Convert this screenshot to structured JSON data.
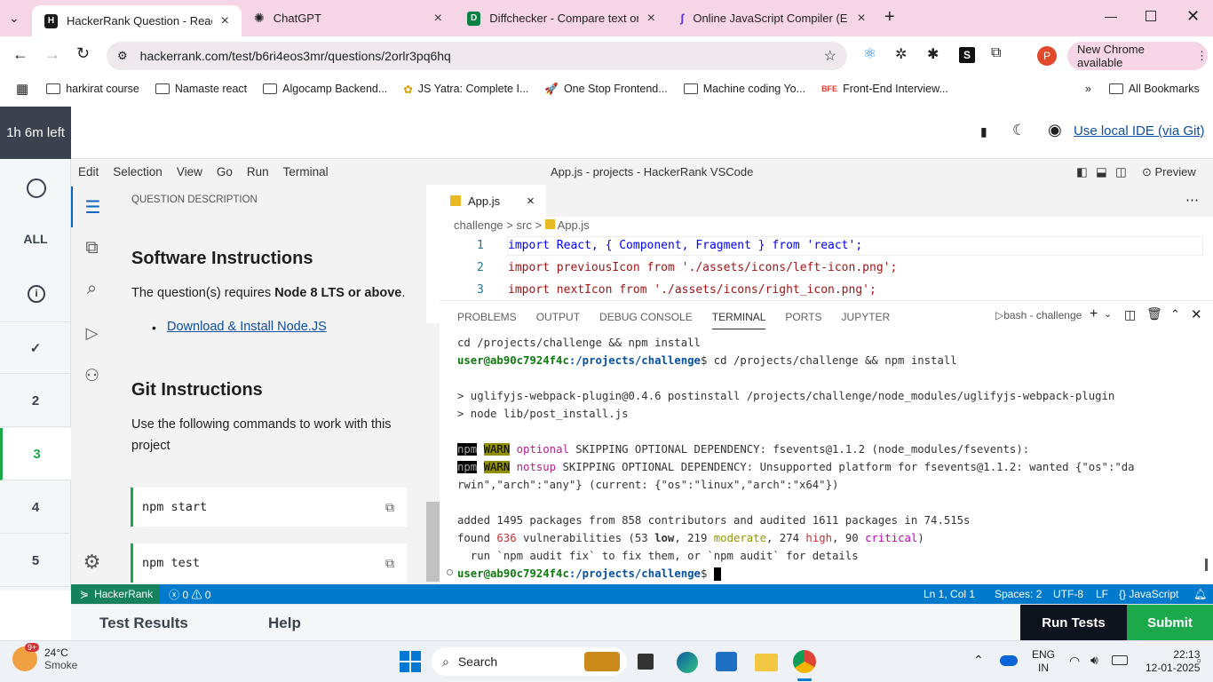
{
  "browser": {
    "tabs": [
      {
        "title": "HackerRank Question - React: C",
        "favicon": "H",
        "color": "#1a1a1a"
      },
      {
        "title": "ChatGPT",
        "favicon": "openai-icon"
      },
      {
        "title": "Diffchecker - Compare text onli",
        "favicon": "D",
        "color": "#0b8043"
      },
      {
        "title": "Online JavaScript Compiler (Edi",
        "favicon": "programiz-icon"
      }
    ],
    "url": "hackerrank.com/test/b6ri4eos3mr/questions/2orlr3pq6hq",
    "profile_letter": "P",
    "update_label": "New Chrome available",
    "bookmarks": [
      "harkirat course",
      "Namaste react",
      "Algocamp Backend...",
      "JS Yatra: Complete I...",
      "One Stop Frontend...",
      "Machine coding Yo...",
      "Front-End Interview..."
    ],
    "all_bookmarks": "All Bookmarks"
  },
  "hr": {
    "timer": "1h 6m left",
    "ide_link": "Use local IDE (via Git)",
    "nav_all": "ALL",
    "questions": [
      "2",
      "3",
      "4",
      "5"
    ],
    "active_question": "3",
    "bottom_tabs": [
      "Test Results",
      "Help"
    ],
    "run_tests": "Run Tests",
    "submit": "Submit"
  },
  "vscode": {
    "menu": [
      "Edit",
      "Selection",
      "View",
      "Go",
      "Run",
      "Terminal"
    ],
    "window_title": "App.js - projects - HackerRank VSCode",
    "preview": "Preview",
    "sidebar": {
      "section": "QUESTION DESCRIPTION",
      "h1": "Software Instructions",
      "req_prefix": "The question(s) requires ",
      "req_bold": "Node 8 LTS or above",
      "req_suffix": ".",
      "link": "Download & Install Node.JS",
      "h2": "Git Instructions",
      "git_text": "Use the following commands to work with this project",
      "commands": [
        "npm start",
        "npm test"
      ]
    },
    "editor": {
      "tab": "App.js",
      "breadcrumb": [
        "challenge",
        "src",
        "App.js"
      ],
      "lines": [
        {
          "n": "1",
          "code": "import React, { Component, Fragment } from 'react';"
        },
        {
          "n": "2",
          "code": "import previousIcon from './assets/icons/left-icon.png';"
        },
        {
          "n": "3",
          "code": "import nextIcon from './assets/icons/right_icon.png';"
        }
      ]
    },
    "panel": {
      "tabs": [
        "PROBLEMS",
        "OUTPUT",
        "DEBUG CONSOLE",
        "TERMINAL",
        "PORTS",
        "JUPYTER"
      ],
      "active_tab": "TERMINAL",
      "shell": "bash - challenge",
      "lines": {
        "l1": "cd /projects/challenge && npm install",
        "prompt_user": "user@ab90c7924f4c",
        "prompt_path": ":/projects/challenge",
        "l2cmd": "$ cd /projects/challenge && npm install",
        "l3": "> uglifyjs-webpack-plugin@0.4.6 postinstall /projects/challenge/node_modules/uglifyjs-webpack-plugin",
        "l4": "> node lib/post_install.js",
        "npm": "npm",
        "warn": "WARN",
        "optional": "optional",
        "w1": " SKIPPING OPTIONAL DEPENDENCY: fsevents@1.1.2 (node_modules/fsevents):",
        "notsup": "notsup",
        "w2": " SKIPPING OPTIONAL DEPENDENCY: Unsupported platform for fsevents@1.1.2: wanted {\"os\":\"da",
        "w3": "rwin\",\"arch\":\"any\"} (current: {\"os\":\"linux\",\"arch\":\"x64\"})",
        "added": "added 1495 packages from 858 contributors and audited 1611 packages in 74.515s",
        "found_prefix": "found ",
        "vuln_count": "636",
        "found_mid": " vulnerabilities (53 ",
        "low": "low",
        "c1": ", 219 ",
        "moderate": "moderate",
        "c2": ", 274 ",
        "high": "high",
        "c3": ", 90 ",
        "critical": "critical",
        "c4": ")",
        "fix": "  run `npm audit fix` to fix them, or `npm audit` for details",
        "prompt_end": "$ "
      }
    },
    "status": {
      "remote": "HackerRank",
      "errors": "0",
      "warnings": "0",
      "position": "Ln 1, Col 1",
      "spaces": "Spaces: 2",
      "encoding": "UTF-8",
      "eol": "LF",
      "language": "JavaScript"
    }
  },
  "taskbar": {
    "weather_badge": "9+",
    "temp": "24°C",
    "condition": "Smoke",
    "search": "Search",
    "lang1": "ENG",
    "lang2": "IN",
    "time": "22:13",
    "date": "12-01-2025"
  }
}
